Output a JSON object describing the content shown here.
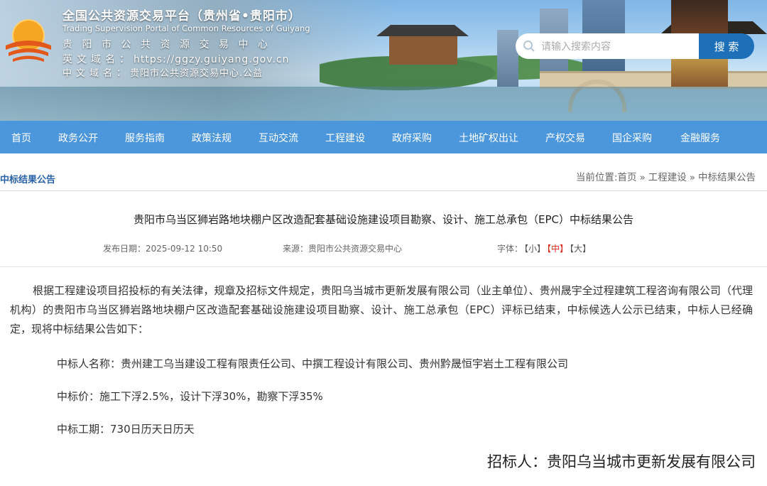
{
  "header": {
    "title": "全国公共资源交易平台（贵州省•贵阳市）",
    "subtitle_en": "Trading Supervision Portal of Common Resources of Guiyang",
    "center_name": "贵阳市公共资源交易中心",
    "en_domain_label": "英文域名：",
    "en_domain": "https://ggzy.guiyang.gov.cn",
    "cn_domain_label": "中文域名：",
    "cn_domain": "贵阳市公共资源交易中心.公益"
  },
  "search": {
    "placeholder": "请输入搜索内容",
    "button_label": "搜 索"
  },
  "nav": {
    "items": [
      "首页",
      "政务公开",
      "服务指南",
      "政策法规",
      "互动交流",
      "工程建设",
      "政府采购",
      "土地矿权出让",
      "产权交易",
      "国企采购",
      "金融服务"
    ]
  },
  "section": {
    "title": "中标结果公告"
  },
  "breadcrumb": {
    "prefix": "当前位置:",
    "items": [
      "首页",
      "工程建设",
      "中标结果公告"
    ],
    "separator": "»"
  },
  "article": {
    "title": "贵阳市乌当区狮岩路地块棚户区改造配套基础设施建设项目勘察、设计、施工总承包（EPC）中标结果公告",
    "publish_label": "发布日期：",
    "publish_date": "2025-09-12 10:50",
    "source_label": "来源：",
    "source": "贵阳市公共资源交易中心",
    "font_label": "字体：",
    "font_small": "【小】",
    "font_medium": "【中】",
    "font_large": "【大】",
    "body": "根据工程建设项目招投标的有关法律，规章及招标文件规定，贵阳乌当城市更新发展有限公司（业主单位）、贵州晟宇全过程建筑工程咨询有限公司（代理机构）的贵阳市乌当区狮岩路地块棚户区改造配套基础设施建设项目勘察、设计、施工总承包（EPC）评标已结束，中标候选人公示已结束，中标人已经确定，现将中标结果公告如下：",
    "winner": "中标人名称：贵州建工乌当建设工程有限责任公司、中撰工程设计有限公司、贵州黔晟恒宇岩土工程有限公司",
    "price": "中标价：施工下浮2.5%，设计下浮30%，勘察下浮35%",
    "duration": "中标工期：730日历天日历天",
    "signer": "招标人：贵阳乌当城市更新发展有限公司"
  },
  "colors": {
    "nav_bg": "#4c97dc",
    "search_button": "#1d6fb8",
    "section_title": "#2a62a8",
    "active_font": "#d9261c"
  }
}
